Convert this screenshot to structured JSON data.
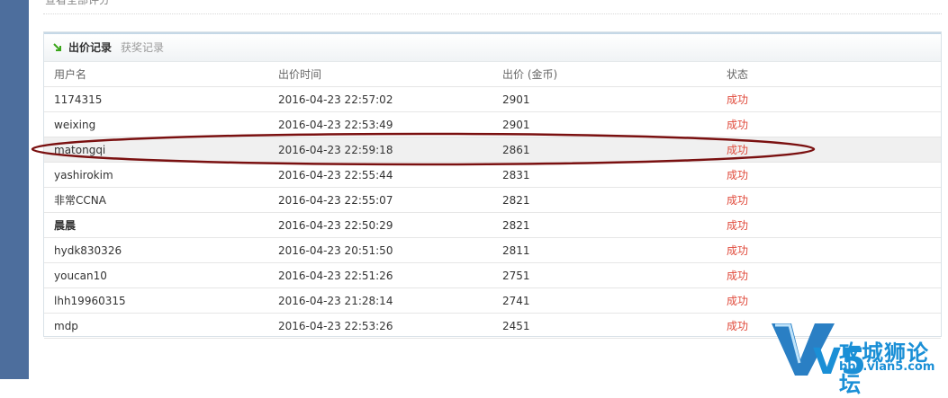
{
  "top": {
    "link_text": "查看全部评分"
  },
  "tabs": [
    {
      "label": "出价记录",
      "active": true
    },
    {
      "label": "获奖记录",
      "active": false
    }
  ],
  "table": {
    "headers": [
      "用户名",
      "出价时间",
      "出价 (金币)",
      "状态"
    ],
    "rows": [
      {
        "user": "1174315",
        "time": "2016-04-23 22:57:02",
        "bid": "2901",
        "status": "成功"
      },
      {
        "user": "weixing",
        "time": "2016-04-23 22:53:49",
        "bid": "2901",
        "status": "成功"
      },
      {
        "user": "matongqi",
        "time": "2016-04-23 22:59:18",
        "bid": "2861",
        "status": "成功"
      },
      {
        "user": "yashirokim",
        "time": "2016-04-23 22:55:44",
        "bid": "2831",
        "status": "成功"
      },
      {
        "user": "非常CCNA",
        "time": "2016-04-23 22:55:07",
        "bid": "2821",
        "status": "成功"
      },
      {
        "user": "晨晨",
        "time": "2016-04-23 22:50:29",
        "bid": "2821",
        "status": "成功"
      },
      {
        "user": "hydk830326",
        "time": "2016-04-23 20:51:50",
        "bid": "2811",
        "status": "成功"
      },
      {
        "user": "youcan10",
        "time": "2016-04-23 22:51:26",
        "bid": "2751",
        "status": "成功"
      },
      {
        "user": "lhh19960315",
        "time": "2016-04-23 21:28:14",
        "bid": "2741",
        "status": "成功"
      },
      {
        "user": "mdp",
        "time": "2016-04-23 22:53:26",
        "bid": "2451",
        "status": "成功"
      }
    ]
  },
  "watermark": {
    "logo_text": "V5",
    "name": "攻城狮论坛",
    "url": "bbs.vlan5.com"
  },
  "colors": {
    "sidebar": "#4d6e9d",
    "status_success": "#e04a3b",
    "annotation": "#7a1010",
    "watermark": "#1a8fd6"
  },
  "icons": {
    "tab_arrow": "green-arrow-icon"
  }
}
